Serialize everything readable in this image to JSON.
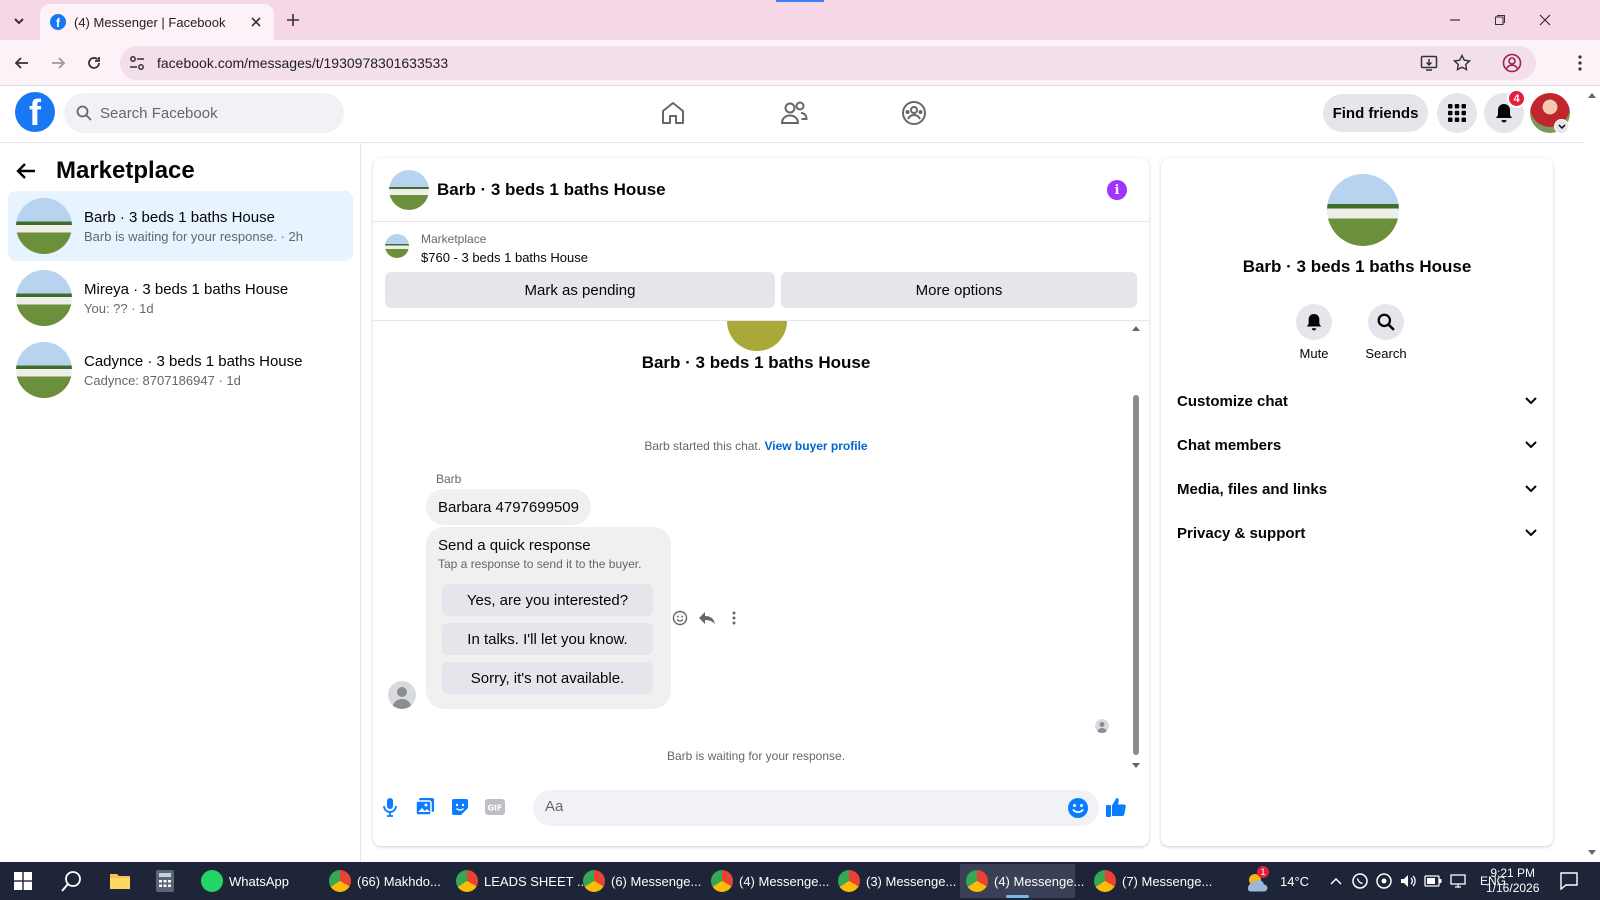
{
  "browser": {
    "tab_title": "(4) Messenger | Facebook",
    "url": "facebook.com/messages/t/1930978301633533"
  },
  "facebook": {
    "search_placeholder": "Search Facebook",
    "find_friends": "Find friends",
    "notification_count": "4",
    "brand_color": "#1877f2"
  },
  "sidebar": {
    "title": "Marketplace",
    "conversations": [
      {
        "name": "Barb · 3 beds 1 baths House",
        "preview": "Barb is waiting for your response. · 2h",
        "active": true
      },
      {
        "name": "Mireya · 3 beds 1 baths House",
        "preview": "You: ?? · 1d",
        "active": false
      },
      {
        "name": "Cadynce · 3 beds 1 baths House",
        "preview": "Cadynce: 8707186947 · 1d",
        "active": false
      }
    ]
  },
  "chat": {
    "header_name": "Barb · 3 beds 1 baths House",
    "marketplace_label": "Marketplace",
    "listing": "$760 - 3 beds 1 baths House",
    "mark_pending": "Mark as pending",
    "more_options": "More options",
    "contact_name": "Barb · 3 beds 1 baths House",
    "started_text": "Barb started this chat.",
    "view_profile": "View buyer profile",
    "sender": "Barb",
    "message": "Barbara 4797699509",
    "quick_title": "Send a quick response",
    "quick_sub": "Tap a response to send it to the buyer.",
    "quick_replies": [
      "Yes, are you interested?",
      "In talks. I'll let you know.",
      "Sorry, it's not available."
    ],
    "waiting_text": "Barb is waiting for your response.",
    "composer_placeholder": "Aa"
  },
  "right_panel": {
    "name": "Barb · 3 beds 1 baths House",
    "mute": "Mute",
    "search": "Search",
    "sections": [
      "Customize chat",
      "Chat members",
      "Media, files and links",
      "Privacy & support"
    ]
  },
  "taskbar": {
    "apps": [
      {
        "label": "WhatsApp",
        "color": "#25d366"
      },
      {
        "label": "(66) Makhdo...",
        "color": "#e8453c"
      },
      {
        "label": "LEADS SHEET ...",
        "color": "#e8453c"
      },
      {
        "label": "(6) Messenge...",
        "color": "#e8453c"
      },
      {
        "label": "(4) Messenge...",
        "color": "#e8453c"
      },
      {
        "label": "(3) Messenge...",
        "color": "#e8453c"
      },
      {
        "label": "(4) Messenge...",
        "color": "#e8453c"
      },
      {
        "label": "(7) Messenge...",
        "color": "#e8453c"
      }
    ],
    "weather_badge": "1",
    "temperature": "14°C",
    "language": "ENG",
    "time": "9:21 PM",
    "date": "1/16/2026"
  }
}
